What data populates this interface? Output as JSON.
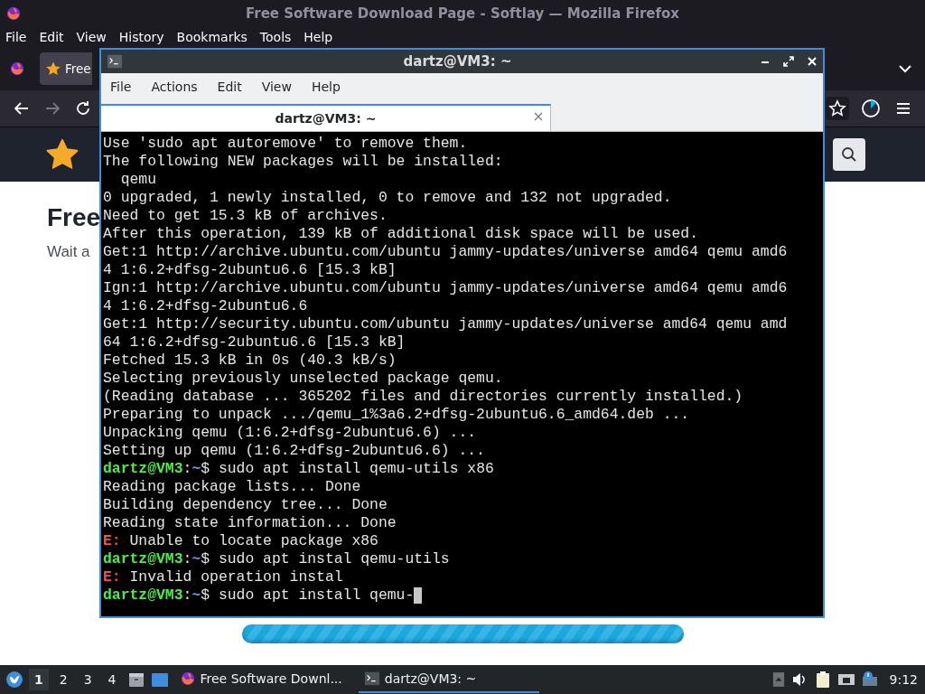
{
  "firefox": {
    "title": "Free Software Download Page - Softlay — Mozilla Firefox",
    "menu": [
      "File",
      "Edit",
      "View",
      "History",
      "Bookmarks",
      "Tools",
      "Help"
    ],
    "tab": {
      "label": "Free"
    },
    "page": {
      "heading": "Free",
      "text": "Wait a",
      "progress": {
        "level": 1
      }
    }
  },
  "terminal": {
    "title": "dartz@VM3: ~",
    "menu": [
      "File",
      "Actions",
      "Edit",
      "View",
      "Help"
    ],
    "tab": {
      "label": "dartz@VM3: ~"
    },
    "lines": [
      {
        "kind": "output",
        "text": "Use 'sudo apt autoremove' to remove them."
      },
      {
        "kind": "output",
        "text": "The following NEW packages will be installed:"
      },
      {
        "kind": "output",
        "text": "  qemu"
      },
      {
        "kind": "output",
        "text": "0 upgraded, 1 newly installed, 0 to remove and 132 not upgraded."
      },
      {
        "kind": "output",
        "text": "Need to get 15.3 kB of archives."
      },
      {
        "kind": "output",
        "text": "After this operation, 139 kB of additional disk space will be used."
      },
      {
        "kind": "output",
        "text": "Get:1 http://archive.ubuntu.com/ubuntu jammy-updates/universe amd64 qemu amd6"
      },
      {
        "kind": "output",
        "text": "4 1:6.2+dfsg-2ubuntu6.6 [15.3 kB]"
      },
      {
        "kind": "output",
        "text": "Ign:1 http://archive.ubuntu.com/ubuntu jammy-updates/universe amd64 qemu amd6"
      },
      {
        "kind": "output",
        "text": "4 1:6.2+dfsg-2ubuntu6.6"
      },
      {
        "kind": "output",
        "text": "Get:1 http://security.ubuntu.com/ubuntu jammy-updates/universe amd64 qemu amd"
      },
      {
        "kind": "output",
        "text": "64 1:6.2+dfsg-2ubuntu6.6 [15.3 kB]"
      },
      {
        "kind": "output",
        "text": "Fetched 15.3 kB in 0s (40.3 kB/s)"
      },
      {
        "kind": "output",
        "text": "Selecting previously unselected package qemu."
      },
      {
        "kind": "output",
        "text": "(Reading database ... 365202 files and directories currently installed.)"
      },
      {
        "kind": "output",
        "text": "Preparing to unpack .../qemu_1%3a6.2+dfsg-2ubuntu6.6_amd64.deb ..."
      },
      {
        "kind": "output",
        "text": "Unpacking qemu (1:6.2+dfsg-2ubuntu6.6) ..."
      },
      {
        "kind": "output",
        "text": "Setting up qemu (1:6.2+dfsg-2ubuntu6.6) ..."
      },
      {
        "kind": "prompt",
        "user": "dartz@VM3",
        "sep": ":",
        "path": "~",
        "sign": "$",
        "command": "sudo apt install qemu-utils x86"
      },
      {
        "kind": "output",
        "text": "Reading package lists... Done"
      },
      {
        "kind": "output",
        "text": "Building dependency tree... Done"
      },
      {
        "kind": "output",
        "text": "Reading state information... Done"
      },
      {
        "kind": "error",
        "tag": "E:",
        "text": "Unable to locate package x86"
      },
      {
        "kind": "prompt",
        "user": "dartz@VM3",
        "sep": ":",
        "path": "~",
        "sign": "$",
        "command": "sudo apt instal qemu-utils"
      },
      {
        "kind": "error",
        "tag": "E:",
        "text": "Invalid operation instal"
      },
      {
        "kind": "prompt",
        "user": "dartz@VM3",
        "sep": ":",
        "path": "~",
        "sign": "$",
        "command": "sudo apt install qemu-",
        "cursor": true
      }
    ]
  },
  "taskbar": {
    "workspaces": [
      {
        "label": "1",
        "selected": true
      },
      {
        "label": "2",
        "selected": false
      },
      {
        "label": "3",
        "selected": false
      },
      {
        "label": "4",
        "selected": false
      }
    ],
    "tasks": [
      {
        "kind": "firefox",
        "label": "Free Software Downl...",
        "selected": false
      },
      {
        "kind": "terminal",
        "label": "dartz@VM3: ~",
        "selected": true
      }
    ],
    "clock": "9:12"
  }
}
